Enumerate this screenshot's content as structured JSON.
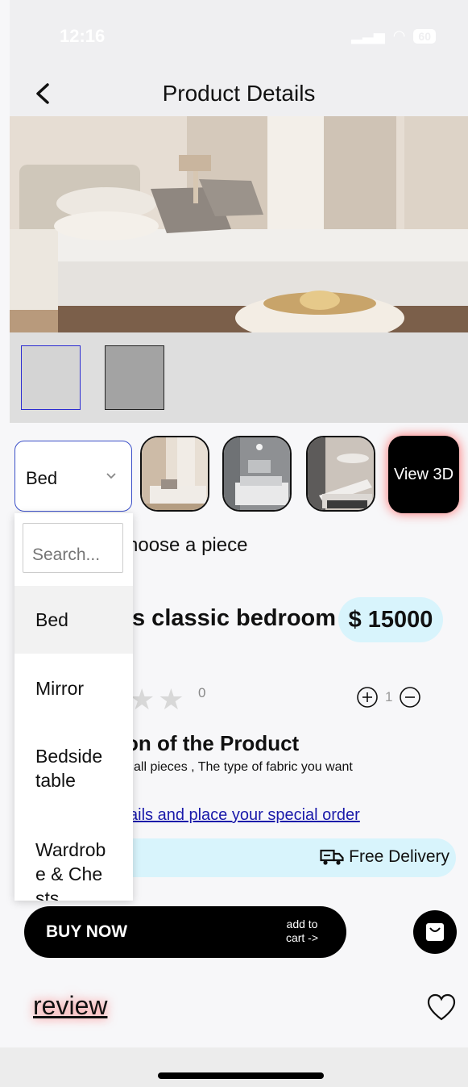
{
  "status": {
    "time": "12:16",
    "battery": "60"
  },
  "header": {
    "title": "Product Details"
  },
  "selector": {
    "value": "Bed",
    "view3d_label": "View 3D"
  },
  "dropdown": {
    "search_placeholder": "Search...",
    "items": [
      "Bed",
      "Mirror",
      "Bedside table",
      "Wardrobe & Chests"
    ]
  },
  "product": {
    "choose_text": "hoose a piece",
    "name": "s classic bedroom",
    "price": "$ 15000",
    "rating_count": "0",
    "quantity": "1",
    "description_title": "on of the Product",
    "description_text": "all pieces , The type of fabric you want",
    "special_order_link": "ails and place your special order",
    "delivery_text": "Free Delivery"
  },
  "actions": {
    "buy_now": "BUY NOW",
    "add_to_cart": "add to cart ->",
    "review": "review"
  },
  "colors": {
    "accent_blue": "#3a4fc8",
    "pill_bg": "#d8f4fc",
    "glow": "#ff6b6b"
  }
}
